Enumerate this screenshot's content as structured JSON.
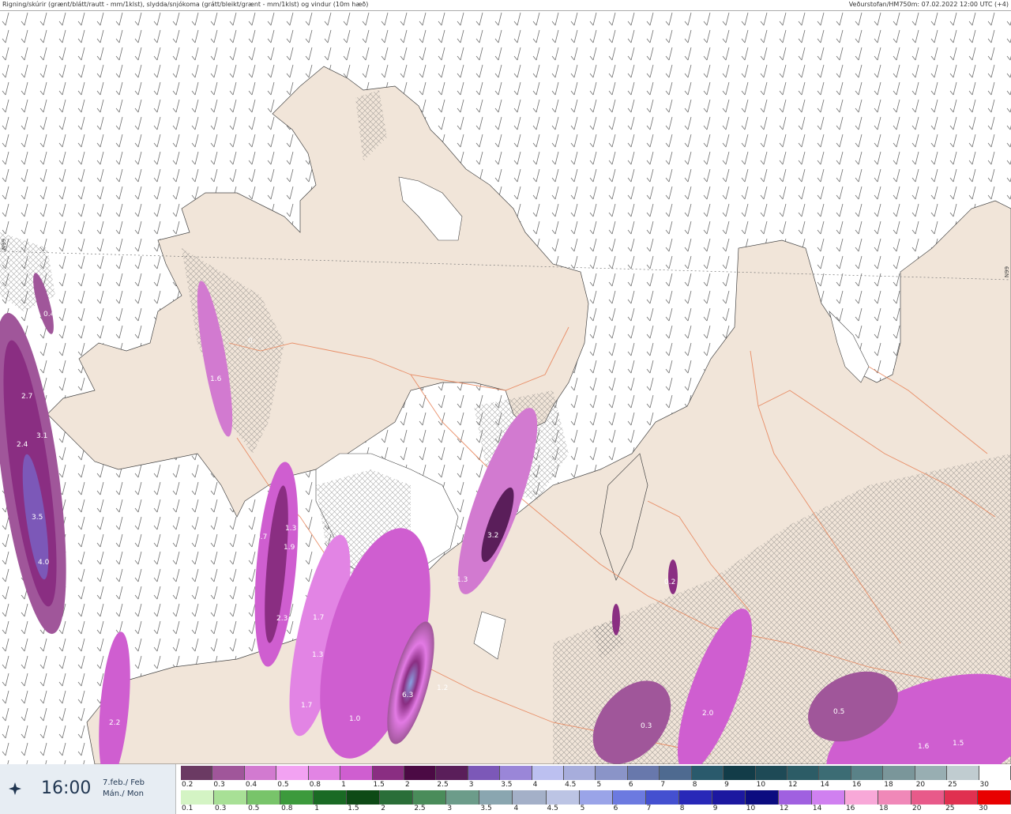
{
  "header": {
    "title": "Rigning/skúrir (grænt/blátt/rautt - mm/1klst), slydda/snjókoma (grátt/bleikt/grænt - mm/1klst) og vindur (10m hæð)",
    "source": "Veðurstofan/HM750m: 07.02.2022 12:00 UTC (+4)"
  },
  "map": {
    "side_label_left": "N99",
    "side_label_right": "N99",
    "precip_labels": [
      "0.4",
      "0.",
      "2.7",
      "3.1",
      "2.4",
      "3.5",
      "4.0",
      "1.6",
      "1.3",
      "0.7",
      "1.9",
      "2.3",
      "1.7",
      "1.3",
      "1.7",
      "1.0",
      "6.3",
      "1.2",
      "3.2",
      "1.3",
      "0.2",
      "0.3",
      "2.0",
      "0.5",
      "1.6",
      "1.5",
      "2.2"
    ],
    "colors": {
      "land": "#f1e5d9",
      "sea": "#ffffff",
      "roads": "#e8845a",
      "wind": "#555555"
    }
  },
  "footer": {
    "time": "16:00",
    "date_line1": "7.feb./ Feb",
    "date_line2": "Mán./ Mon",
    "play_icon": "play-arrows-icon",
    "snow_scale": {
      "labels": [
        "0.2",
        "0.3",
        "0.4",
        "0.5",
        "0.8",
        "1",
        "1.5",
        "2",
        "2.5",
        "3",
        "3.5",
        "4",
        "4.5",
        "5",
        "6",
        "7",
        "8",
        "9",
        "10",
        "12",
        "14",
        "16",
        "18",
        "20",
        "25",
        "30"
      ],
      "colors": [
        "#6b3a63",
        "#a0569a",
        "#d27ad0",
        "#f2a2f2",
        "#e284e4",
        "#cf5ed0",
        "#8a2e82",
        "#4b0a44",
        "#5a1e5a",
        "#7c58b8",
        "#9a86d8",
        "#bcc0f0",
        "#a7addc",
        "#8a94c8",
        "#6878ac",
        "#4e6a90",
        "#2a5a6c",
        "#123c48",
        "#1e4a56",
        "#2c5c66",
        "#3c6c74",
        "#5a8288",
        "#7a969a",
        "#98aeb2",
        "#c0ccd0",
        "#ffffff"
      ]
    },
    "rain_scale": {
      "labels": [
        "0.1",
        "0.3",
        "0.5",
        "0.8",
        "1",
        "1.5",
        "2",
        "2.5",
        "3",
        "3.5",
        "4",
        "4.5",
        "5",
        "6",
        "7",
        "8",
        "9",
        "10",
        "12",
        "14",
        "16",
        "18",
        "20",
        "25",
        "30"
      ],
      "colors": [
        "#d4f4c4",
        "#a8e096",
        "#78c46a",
        "#3c9a3c",
        "#1a6a24",
        "#0e4a16",
        "#2a6e38",
        "#4a8c5a",
        "#6c9c8a",
        "#8aa6b0",
        "#a4b0c8",
        "#bcc4e4",
        "#9aa4e8",
        "#6c7ae0",
        "#4450d0",
        "#2828b8",
        "#1c18a0",
        "#0c0c80",
        "#a060e0",
        "#d080f0",
        "#f8a8d8",
        "#f088b8",
        "#e85a8a",
        "#e03050",
        "#e80000"
      ]
    }
  }
}
